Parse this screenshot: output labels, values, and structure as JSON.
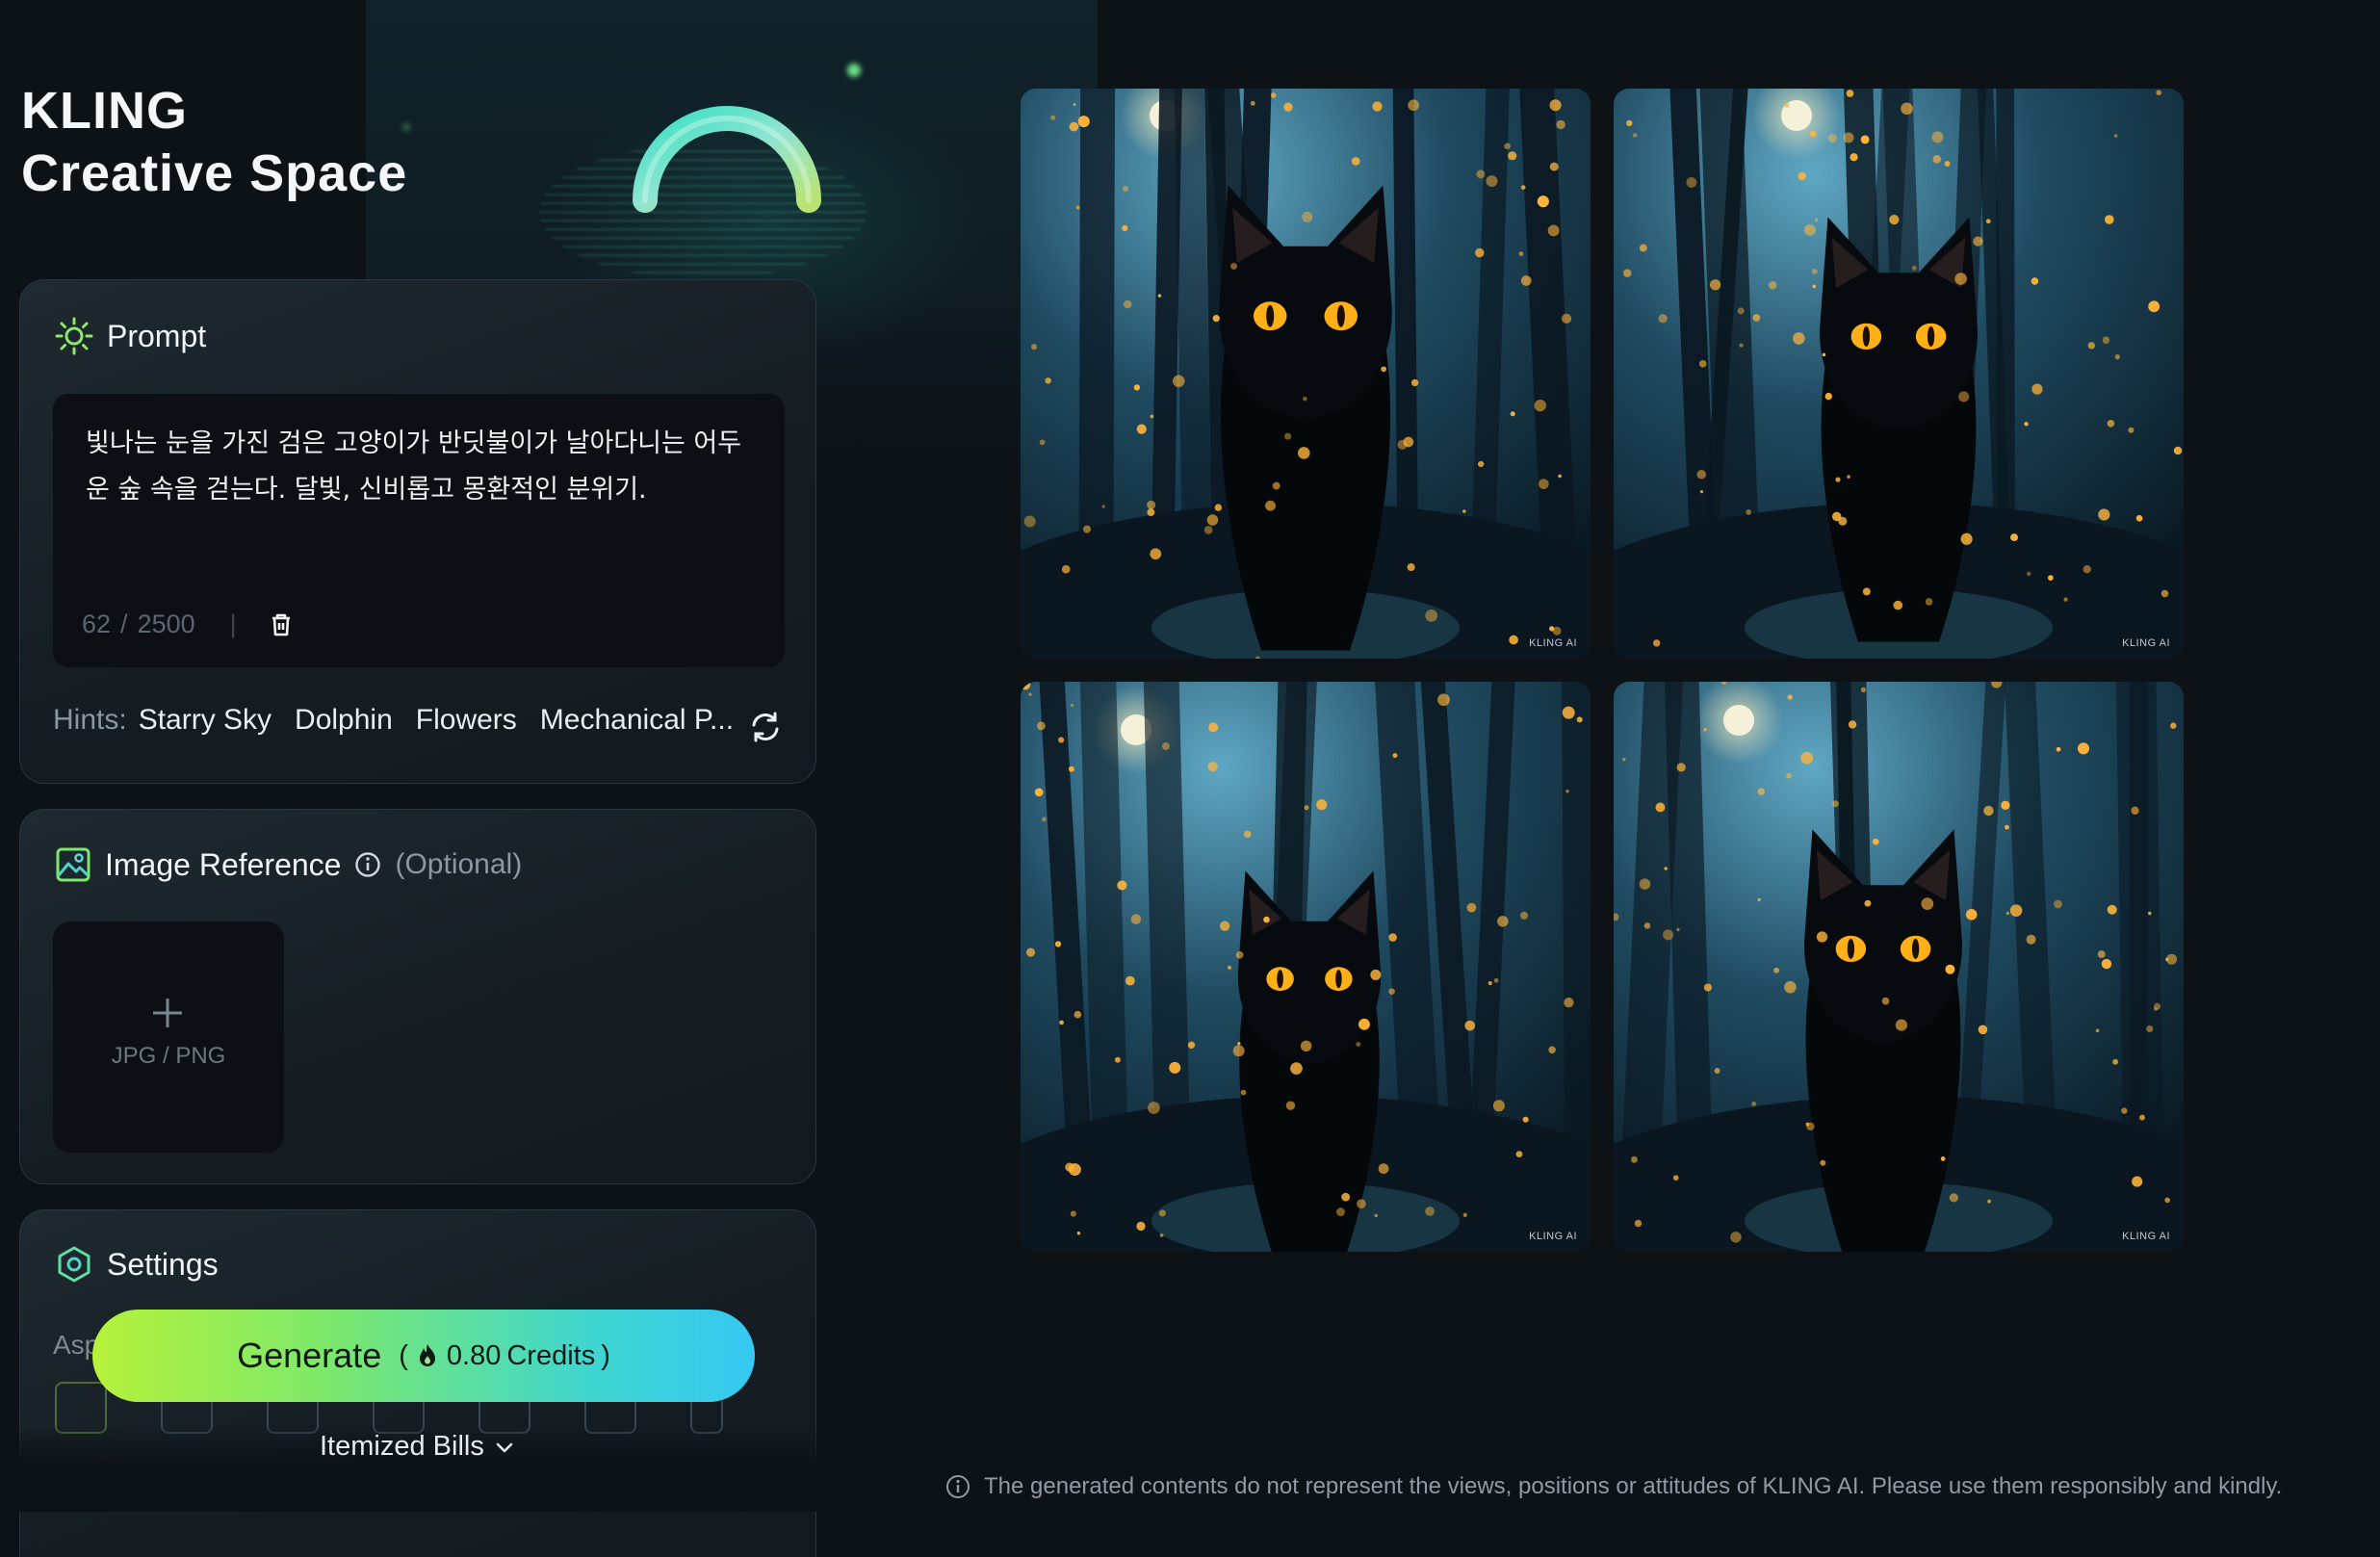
{
  "brand": {
    "line1": "KLING",
    "line2": "Creative Space"
  },
  "prompt": {
    "title": "Prompt",
    "icon": "sun-icon",
    "text": "빛나는 눈을 가진 검은 고양이가 반딧불이가 날아다니는 어두운 숲 속을 걷는다. 달빛, 신비롭고 몽환적인 분위기.",
    "count": "62",
    "limit": "2500",
    "count_sep": "/",
    "hints_label": "Hints:",
    "hints": [
      "Starry Sky",
      "Dolphin",
      "Flowers",
      "Mechanical P..."
    ]
  },
  "image_reference": {
    "title": "Image Reference",
    "optional": "(Optional)",
    "upload_label": "JPG / PNG"
  },
  "settings": {
    "title": "Settings",
    "aspect_label": "Asp"
  },
  "generate": {
    "label": "Generate",
    "credits_open": "(",
    "credits": "0.80",
    "credits_unit": "Credits",
    "credits_close": ")"
  },
  "itemized_bills": "Itemized Bills",
  "watermark": "KLING AI",
  "footer_note": "The generated contents do not represent the views, positions or attitudes of KLING AI. Please use them responsibly and kindly.",
  "colors": {
    "background": "#0d1217",
    "accent_green": "#7de86a",
    "accent_cyan": "#36c8f2",
    "firefly": "#ffb43a"
  }
}
